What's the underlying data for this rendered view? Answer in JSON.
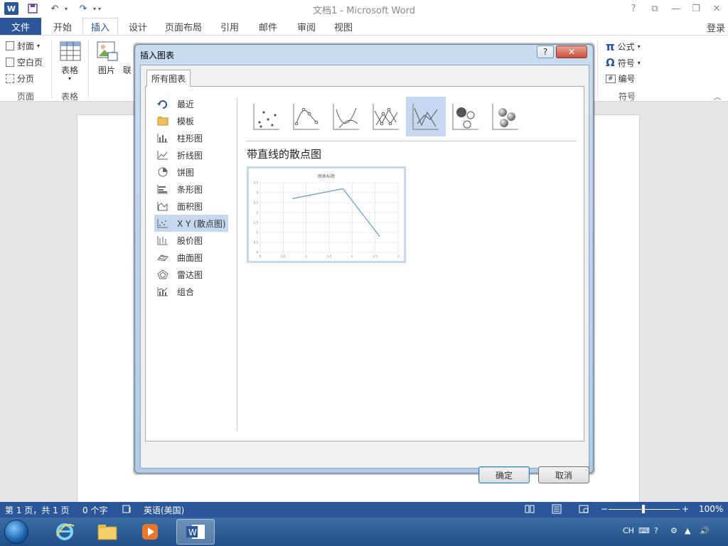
{
  "window": {
    "title": "文档1 - Microsoft Word",
    "logo": "W",
    "controls": [
      "?",
      "⧉",
      "—",
      "❐",
      "✕"
    ]
  },
  "quick_access": {
    "save": "save-icon",
    "undo": "undo-icon",
    "redo": "redo-icon"
  },
  "ribbon": {
    "file_tab": "文件",
    "tabs": [
      "开始",
      "插入",
      "设计",
      "页面布局",
      "引用",
      "邮件",
      "审阅",
      "视图"
    ],
    "active_tab": "插入",
    "login": "登录",
    "pages_group": {
      "items": [
        "封面",
        "空白页",
        "分页"
      ],
      "label": "页面"
    },
    "table_group": {
      "button": "表格",
      "label": "表格"
    },
    "illustrations": {
      "picture": "图片",
      "online": "联"
    },
    "symbols_group": {
      "items": [
        "公式",
        "符号",
        "编号"
      ],
      "label": "符号"
    }
  },
  "dialog": {
    "title": "插入图表",
    "help": "?",
    "close": "✕",
    "tab": "所有图表",
    "chart_types": [
      "最近",
      "模板",
      "柱形图",
      "折线图",
      "饼图",
      "条形图",
      "面积图",
      "X Y (散点图)",
      "股价图",
      "曲面图",
      "雷达图",
      "组合"
    ],
    "selected_type": "X Y (散点图)",
    "subtype_title": "带直线的散点图",
    "ok": "确定",
    "cancel": "取消"
  },
  "chart_data": {
    "type": "line",
    "title": "图表标题",
    "x": [
      0.7,
      1.8,
      2.6
    ],
    "values": [
      2.7,
      3.2,
      0.8
    ],
    "xlim": [
      0,
      3
    ],
    "ylim": [
      0,
      3.5
    ],
    "x_ticks": [
      "0",
      "0.5",
      "1",
      "1.5",
      "2",
      "2.5",
      "3"
    ],
    "y_ticks": [
      "0",
      "0.5",
      "1",
      "1.5",
      "2",
      "2.5",
      "3",
      "3.5"
    ],
    "grid": true,
    "series_color": "#5b9bd5"
  },
  "status": {
    "page": "第 1 页，共 1 页",
    "words": "0 个字",
    "language": "英语(美国)",
    "zoom": "100%",
    "zoom_minus": "−",
    "zoom_plus": "+"
  },
  "taskbar": {
    "tray_lang": "CH",
    "apps": [
      "ie-icon",
      "explorer-icon",
      "media-player-icon",
      "word-icon"
    ]
  },
  "colors": {
    "accent": "#2b579a",
    "selection": "#c5d8ef"
  }
}
